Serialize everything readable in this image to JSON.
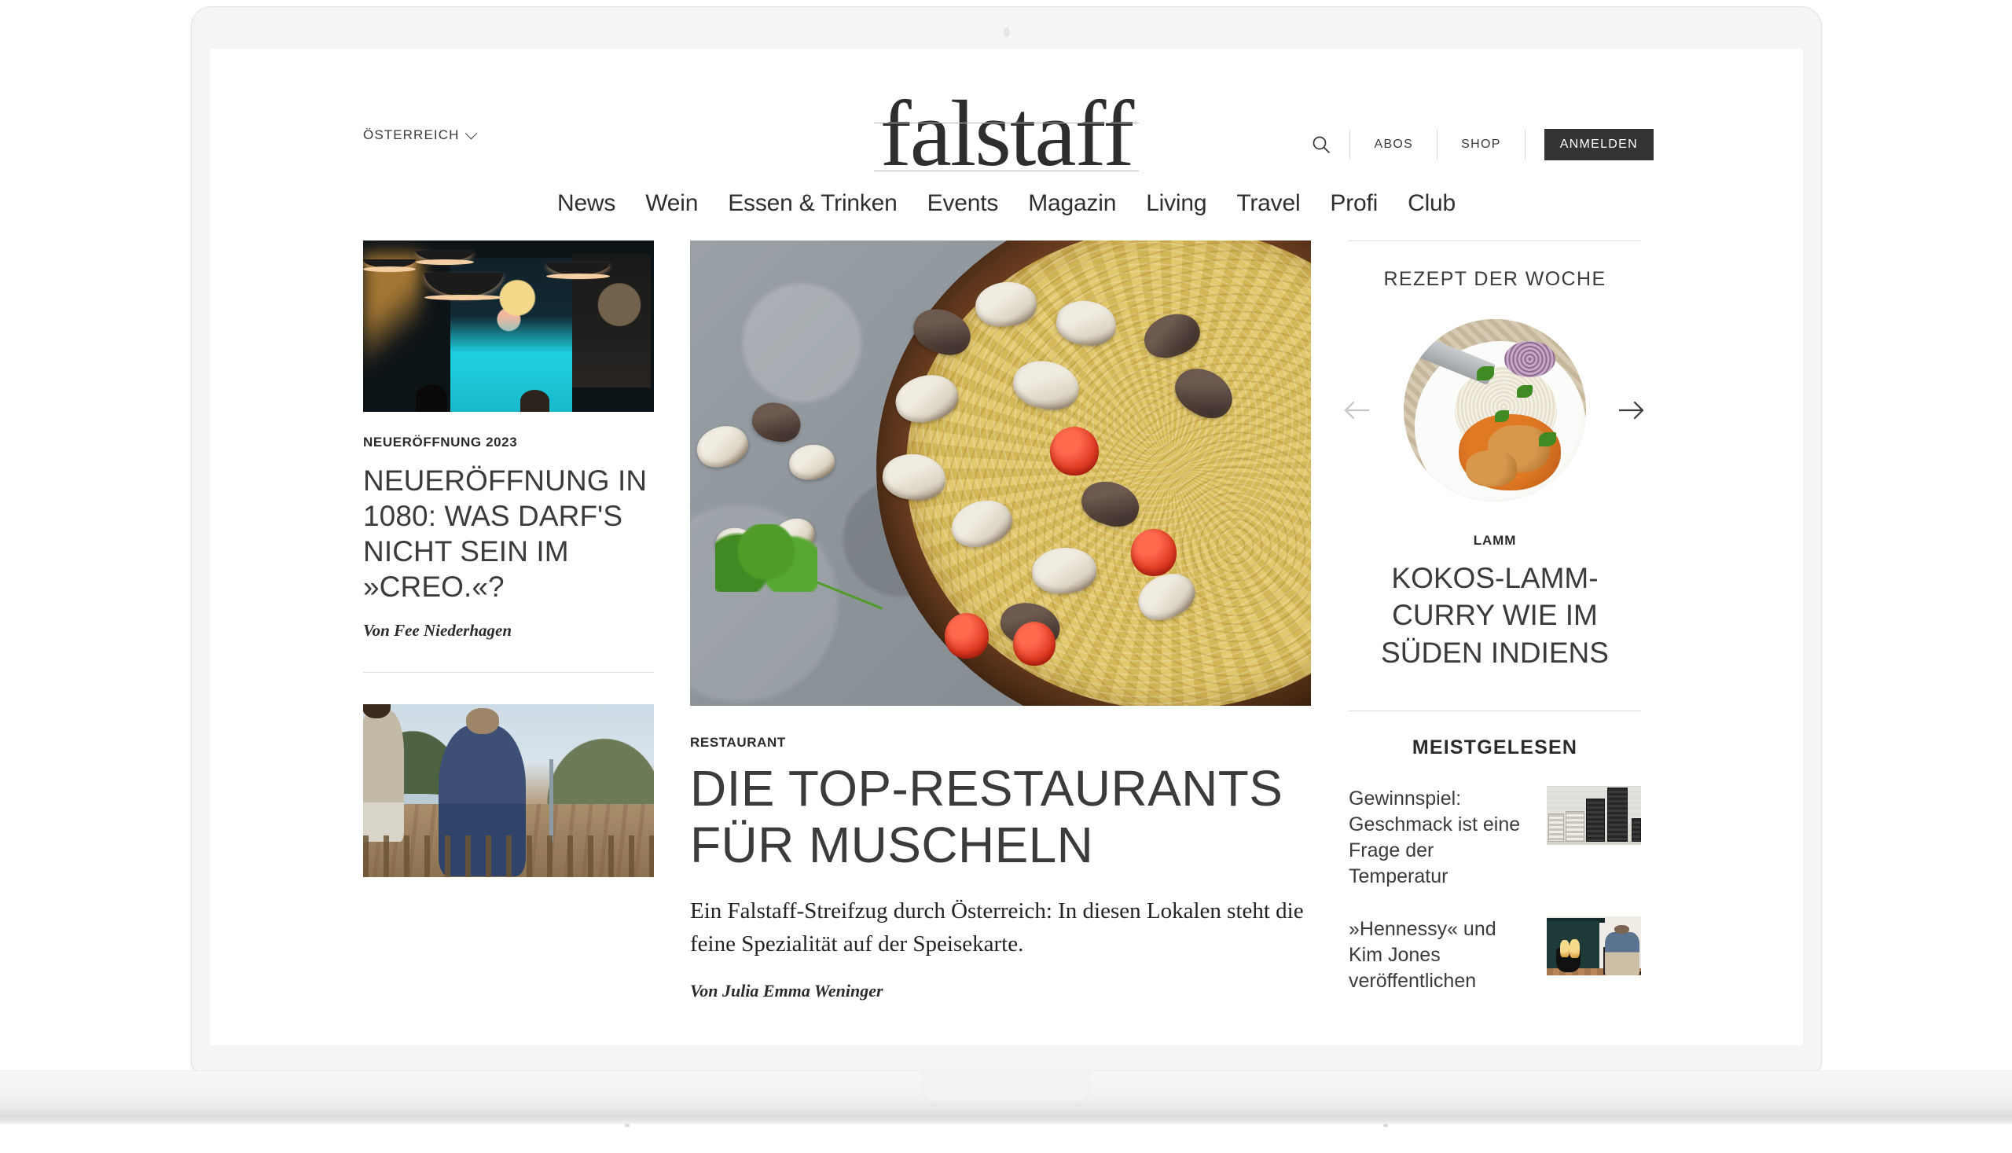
{
  "header": {
    "region_label": "ÖSTERREICH",
    "region_caret": "chevron-down-icon",
    "brand": "falstaff",
    "search_icon": "search-icon",
    "links": [
      "ABOS",
      "SHOP"
    ],
    "login_label": "ANMELDEN"
  },
  "nav": {
    "items": [
      "News",
      "Wein",
      "Essen & Trinken",
      "Events",
      "Magazin",
      "Living",
      "Travel",
      "Profi",
      "Club"
    ]
  },
  "left_column": {
    "article1": {
      "image_alt": "Dunkler Restaurant-Innenraum mit Pendelleuchten und buntem Wandbild",
      "kicker": "NEUERÖFFNUNG 2023",
      "headline": "NEUERÖFFNUNG IN 1080: WAS DARF'S NICHT SEIN IM »CREO.«?",
      "byline": "Von Fee Niederhagen"
    },
    "article2": {
      "image_alt": "Zwei Männer gehen durch einen Weingarten"
    }
  },
  "main_article": {
    "image_alt": "Spaghetti alle Vongole in einer Pfanne mit Tomaten und Petersilie",
    "kicker": "RESTAURANT",
    "headline": "DIE TOP-RESTAURANTS FÜR MUSCHELN",
    "teaser": "Ein Falstaff-Streifzug durch Österreich: In diesen Lokalen steht die feine Spezialität auf der Speisekarte.",
    "byline": "Von Julia Emma Weninger"
  },
  "sidebar": {
    "recipe_section": {
      "title": "REZEPT DER WOCHE",
      "prev_icon": "arrow-left-icon",
      "next_icon": "arrow-right-icon",
      "image_alt": "Teller mit Kokos-Lamm-Curry, Reis und roten Zwiebeln",
      "kicker": "LAMM",
      "title_text": "KOKOS-LAMM-CURRY WIE IM SÜDEN INDIENS"
    },
    "most_read": {
      "title": "MEISTGELESEN",
      "items": [
        {
          "text": "Gewinnspiel: Geschmack ist eine Frage der Temperatur",
          "image_alt": "Weinklimaschränke vor heller Wand"
        },
        {
          "text": "»Hennessy« und Kim Jones veröffentlichen",
          "image_alt": "Mann sitzt neben Kamin mit Cognacflaschen"
        }
      ]
    }
  },
  "colors": {
    "text_dark": "#2b2b2b",
    "text_body": "#3b3b3b",
    "accent_button": "#333333",
    "divider": "#dcdcdc",
    "page_bg": "#ffffff",
    "device_bg": "#f5f5f5"
  }
}
